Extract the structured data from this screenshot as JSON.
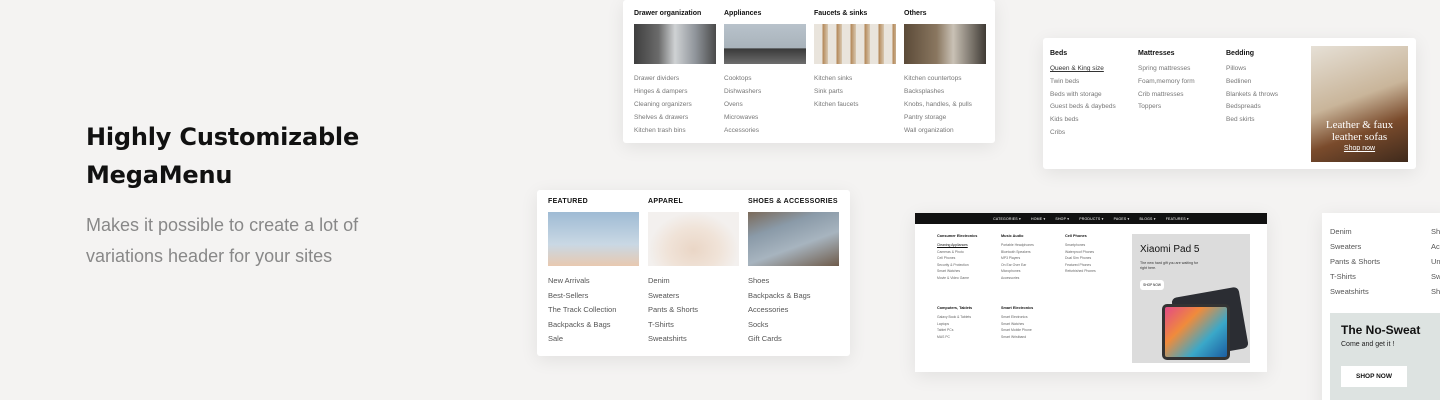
{
  "hero": {
    "title_line1": "Highly Customizable",
    "title_line2": "MegaMenu",
    "subtitle_line1": "Makes it possible to create a lot of",
    "subtitle_line2": "variations header for your sites"
  },
  "kitchen_menu": {
    "columns": [
      {
        "heading": "Drawer organization",
        "items": [
          "Drawer dividers",
          "Hinges & dampers",
          "Cleaning organizers",
          "Shelves & drawers",
          "Kitchen trash bins"
        ]
      },
      {
        "heading": "Appliances",
        "items": [
          "Cooktops",
          "Dishwashers",
          "Ovens",
          "Microwaves",
          "Accessories"
        ]
      },
      {
        "heading": "Faucets & sinks",
        "items": [
          "Kitchen sinks",
          "Sink parts",
          "Kitchen faucets"
        ]
      },
      {
        "heading": "Others",
        "items": [
          "Kitchen countertops",
          "Backsplashes",
          "Knobs, handles, & pulls",
          "Pantry storage",
          "Wall organization"
        ]
      }
    ]
  },
  "bedroom_menu": {
    "columns": [
      {
        "heading": "Beds",
        "items": [
          "Queen & King size",
          "Twin beds",
          "Beds with storage",
          "Guest beds & daybeds",
          "Kids beds",
          "Cribs"
        ]
      },
      {
        "heading": "Mattresses",
        "items": [
          "Spring mattresses",
          "Foam,memory form",
          "Crib mattresses",
          "Toppers"
        ]
      },
      {
        "heading": "Bedding",
        "items": [
          "Pillows",
          "Bedlinen",
          "Blankets & throws",
          "Bedspreads",
          "Bed skirts"
        ]
      }
    ],
    "promo": {
      "title_line1": "Leather & faux",
      "title_line2": "leather sofas",
      "link": "Shop now"
    }
  },
  "apparel_menu": {
    "columns": [
      {
        "heading": "FEATURED",
        "items": [
          "New Arrivals",
          "Best-Sellers",
          "The Track Collection",
          "Backpacks & Bags",
          "Sale"
        ]
      },
      {
        "heading": "APPAREL",
        "items": [
          "Denim",
          "Sweaters",
          "Pants & Shorts",
          "T-Shirts",
          "Sweatshirts"
        ]
      },
      {
        "heading": "SHOES & ACCESSORIES",
        "items": [
          "Shoes",
          "Backpacks & Bags",
          "Accessories",
          "Socks",
          "Gift Cards"
        ]
      }
    ]
  },
  "electronics_menu": {
    "nav": [
      "CATEGORIES ▾",
      "HOME ▾",
      "SHOP ▾",
      "PRODUCTS ▾",
      "PAGES ▾",
      "BLOGS ▾",
      "FEATURES ▾"
    ],
    "columns": [
      {
        "heading": "Consumer Electronics",
        "items": [
          "Cleaning Appliances",
          "Cameras & Photo",
          "Cell Phones",
          "Security & Protection",
          "Smart Watches",
          "Movie & Video Game"
        ]
      },
      {
        "heading": "Music Audio",
        "items": [
          "Portable Headphones",
          "Bluetooth Speakers",
          "MP3 Players",
          "On Ear Over Ear",
          "Microphones",
          "Accessories"
        ]
      },
      {
        "heading": "Cell Phones",
        "items": [
          "Smartphones",
          "Waterproof Phones",
          "Dual Sim Phones",
          "Featured Phones",
          "Refurbished Phones"
        ]
      },
      {
        "heading": "Computers, Tablets",
        "items": [
          "Galaxy Book & Tablets",
          "Laptops",
          "Tablet PCs",
          "MAS PC"
        ]
      },
      {
        "heading": "Smart Electronics",
        "items": [
          "Smart Electronics",
          "Smart Watches",
          "Smart Mobile Phone",
          "Smart Wristband"
        ]
      }
    ],
    "promo": {
      "title": "Xiaomi Pad 5",
      "subtitle": "The new hard gift you are waiting for right here.",
      "button": "SHOP NOW"
    }
  },
  "partial_menu": {
    "col1": [
      "Denim",
      "Sweaters",
      "Pants & Shorts",
      "T-Shirts",
      "Sweatshirts"
    ],
    "col2": [
      "Sh",
      "Ac",
      "Un",
      "Sw",
      "Sh"
    ],
    "promo": {
      "title": "The No-Sweat",
      "subtitle": "Come and get it !",
      "button": "SHOP NOW"
    }
  }
}
